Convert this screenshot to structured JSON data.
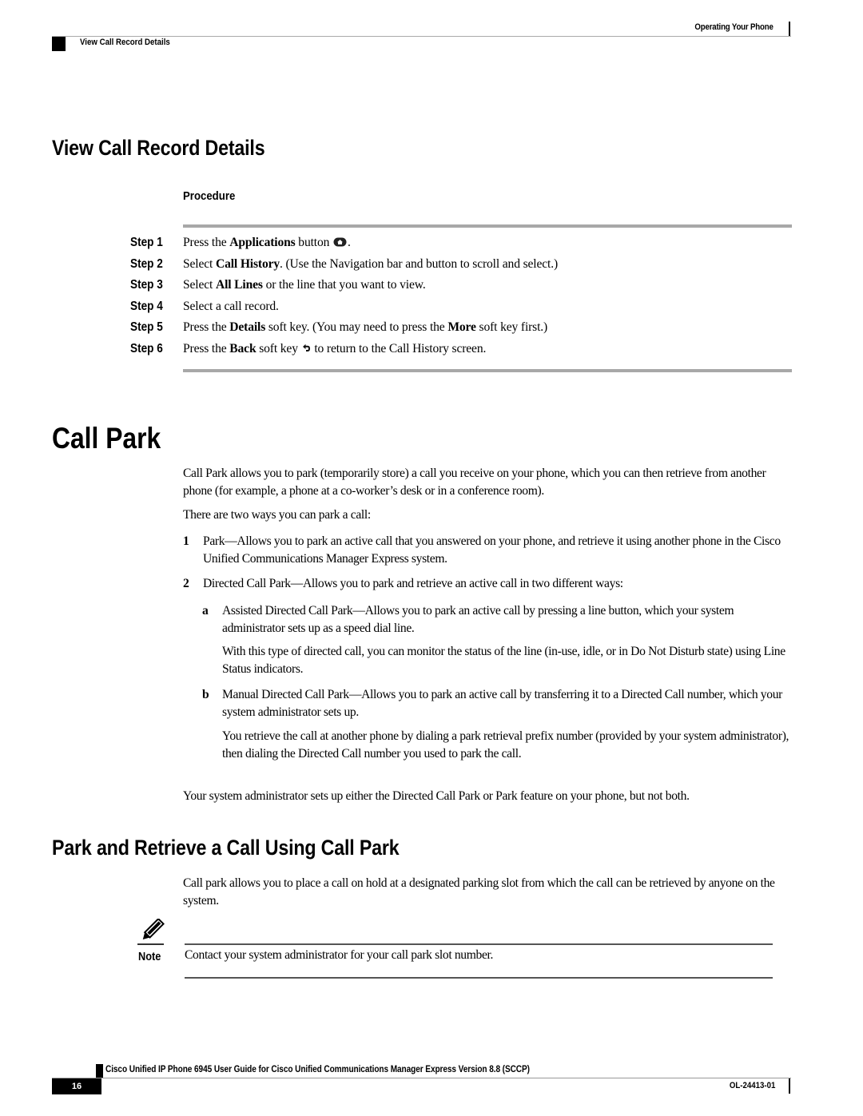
{
  "header": {
    "chapter": "Operating Your Phone",
    "section": "View Call Record Details"
  },
  "view_call_record": {
    "title": "View Call Record Details",
    "procedure_label": "Procedure",
    "steps": [
      {
        "label": "Step 1",
        "pre": "Press the ",
        "bold": "Applications",
        "post": " button",
        "icon": "applications-button-icon",
        "tail": "."
      },
      {
        "label": "Step 2",
        "pre": "Select ",
        "bold": "Call History",
        "post": ". (Use the Navigation bar and button to scroll and select.)"
      },
      {
        "label": "Step 3",
        "pre": "Select ",
        "bold": "All Lines",
        "post": " or the line that you want to view."
      },
      {
        "label": "Step 4",
        "pre": "Select a call record.",
        "bold": "",
        "post": ""
      },
      {
        "label": "Step 5",
        "pre": "Press the ",
        "bold": "Details",
        "post": " soft key. (You may need to press the ",
        "bold2": "More",
        "post2": " soft key first.)"
      },
      {
        "label": "Step 6",
        "pre": "Press the ",
        "bold": "Back",
        "post": " soft key",
        "icon": "back-arrow-icon",
        "tail": " to return to the Call History screen."
      }
    ]
  },
  "call_park": {
    "title": "Call Park",
    "intro": "Call Park allows you to park (temporarily store) a call you receive on your phone, which you can then retrieve from another phone (for example, a phone at a co-worker’s desk or in a conference room).",
    "ways_intro": "There are two ways you can park a call:",
    "items": [
      {
        "num": "1",
        "text": "Park—Allows you to park an active call that you answered on your phone, and retrieve it using another phone in the Cisco Unified Communications Manager Express system."
      },
      {
        "num": "2",
        "text": "Directed Call Park—Allows you to park and retrieve an active call in two different ways:"
      }
    ],
    "sub_items": [
      {
        "label": "a",
        "text": "Assisted Directed Call Park—Allows you to park an active call by pressing a line button, which your system administrator sets up as a speed dial line.",
        "extra": "With this type of directed call, you can monitor the status of the line (in-use, idle, or in Do Not Disturb state) using Line Status indicators."
      },
      {
        "label": "b",
        "text": "Manual Directed Call Park—Allows you to park an active call by transferring it to a Directed Call number, which your system administrator sets up.",
        "extra": "You retrieve the call at another phone by dialing a park retrieval prefix number (provided by your system administrator), then dialing the Directed Call number you used to park the call."
      }
    ],
    "closing": "Your system administrator sets up either the Directed Call Park or Park feature on your phone, but not both."
  },
  "park_retrieve": {
    "title": "Park and Retrieve a Call Using Call Park",
    "intro": "Call park allows you to place a call on hold at a designated parking slot from which the call can be retrieved by anyone on the system.",
    "note_label": "Note",
    "note_text": "Contact your system administrator for your call park slot number."
  },
  "footer": {
    "title": "Cisco Unified IP Phone 6945 User Guide for Cisco Unified Communications Manager Express Version 8.8 (SCCP)",
    "page_number": "16",
    "doc_id": "OL-24413-01"
  }
}
